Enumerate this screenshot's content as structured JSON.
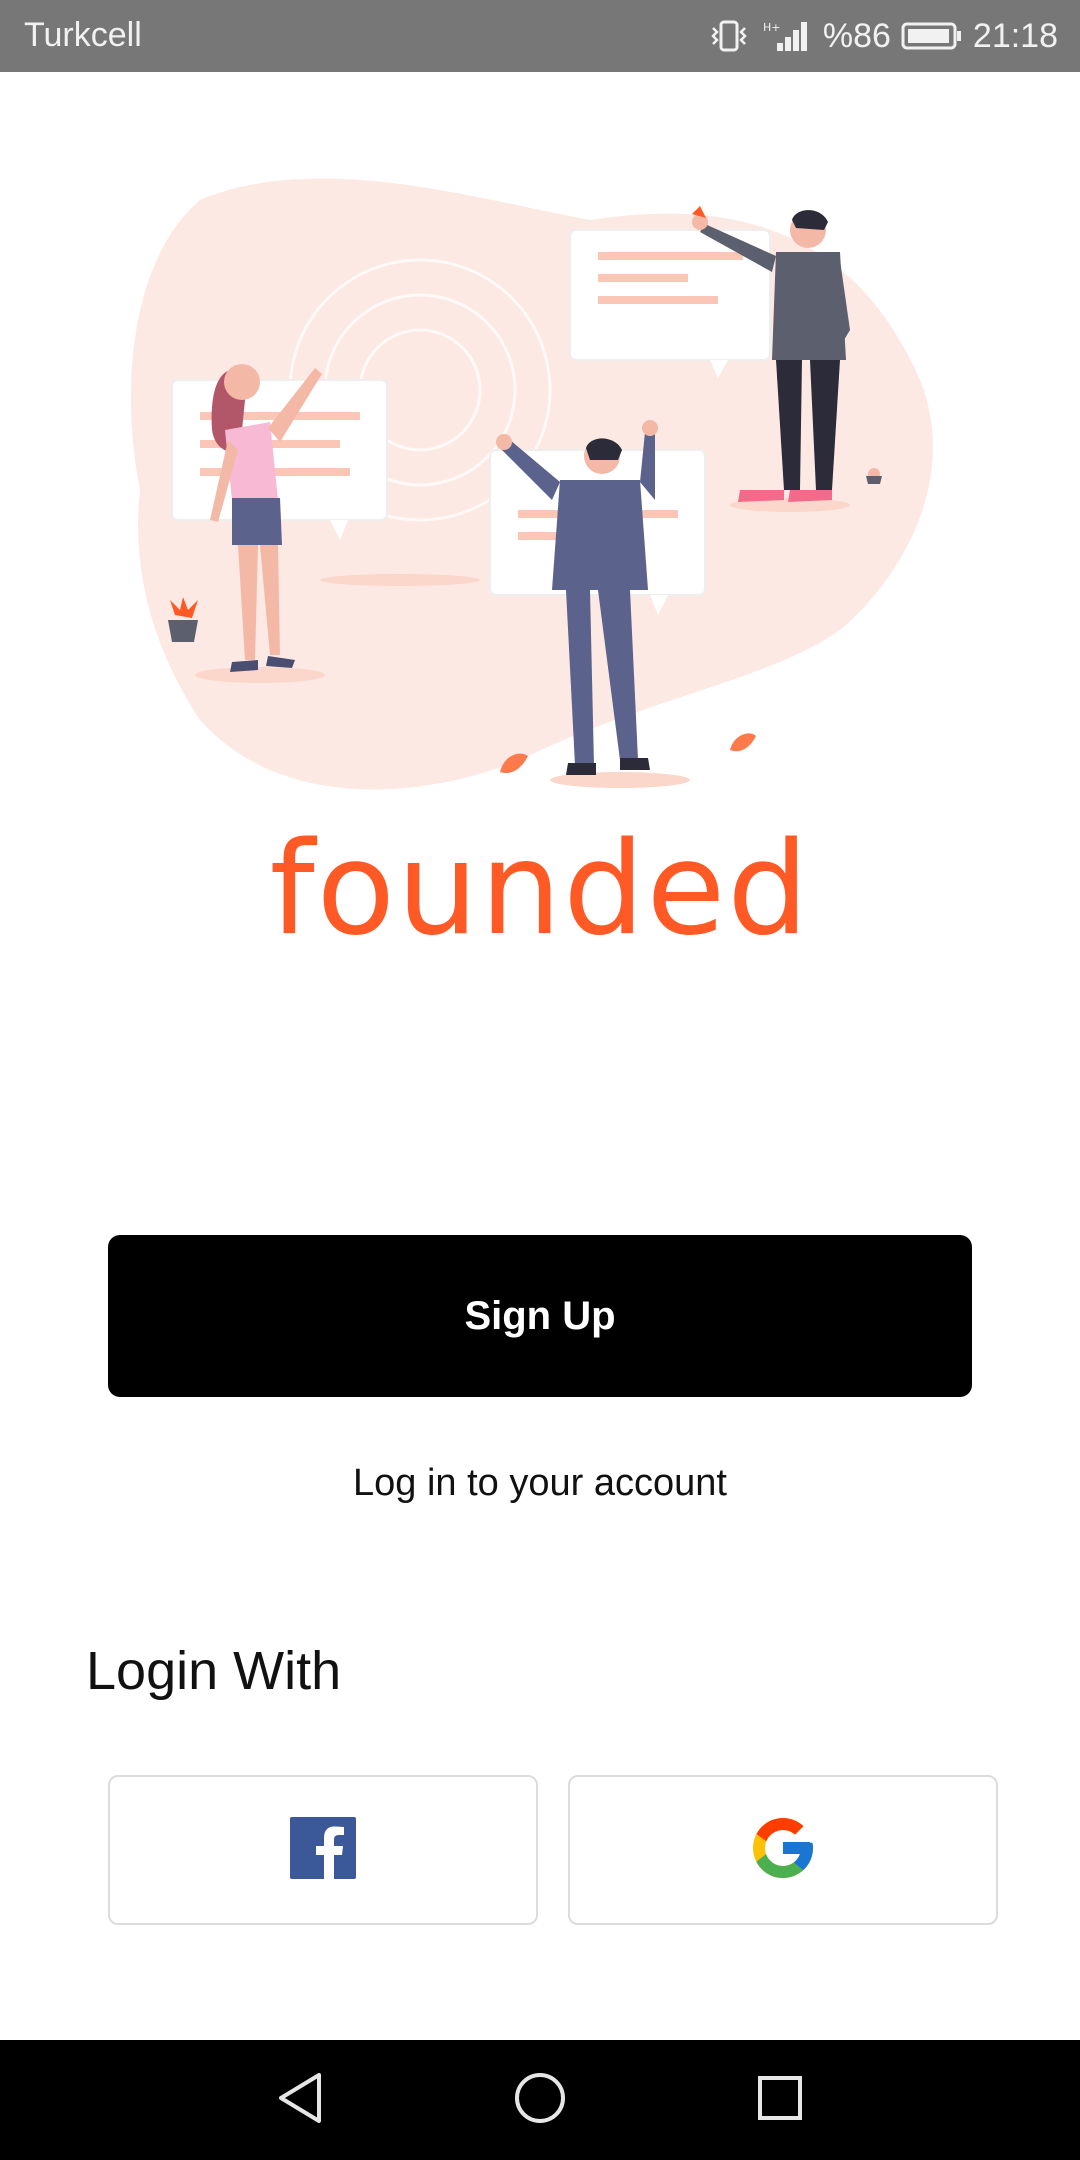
{
  "status_bar": {
    "carrier": "Turkcell",
    "battery": "%86",
    "time": "21:18",
    "icons": [
      "vibrate-icon",
      "signal-icon",
      "battery-icon"
    ]
  },
  "brand": {
    "logo_text": "founded",
    "color": "#ff5a26"
  },
  "actions": {
    "signup_label": "Sign Up",
    "login_link": "Log in to your account"
  },
  "social": {
    "title": "Login With",
    "providers": [
      "facebook-icon",
      "google-icon"
    ]
  },
  "nav_bar": {
    "icons": [
      "back-icon",
      "home-icon",
      "recents-icon"
    ]
  },
  "colors": {
    "status_bar": "#777777",
    "button_bg": "#000000",
    "facebook": "#3b5998",
    "illustration_blob": "#fde9e4"
  }
}
